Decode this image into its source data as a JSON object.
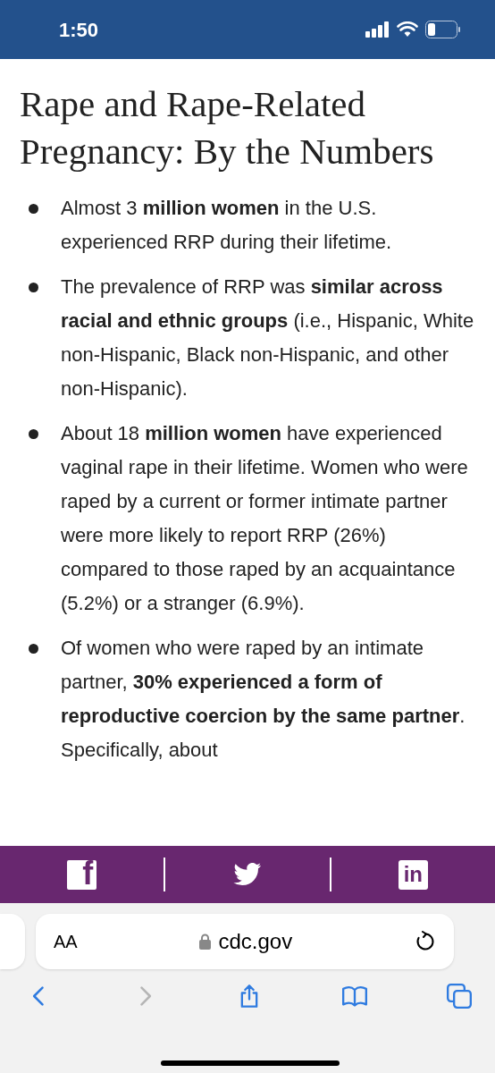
{
  "status_bar": {
    "time": "1:50"
  },
  "article": {
    "title": "Rape and Rape-Related Pregnancy: By the Numbers",
    "bullets": [
      "Almost 3 **million women** in the U.S. experienced RRP during their lifetime.",
      "The prevalence of RRP was **similar across racial and ethnic groups** (i.e., Hispanic, White non-Hispanic, Black non-Hispanic, and other non-Hispanic).",
      "About 18 **million women** have experienced vaginal rape in their lifetime. Women who were raped by a current or former intimate partner were more likely to report RRP (26%) compared to those raped by an acquaintance (5.2%) or a stranger (6.9%).",
      "Of women who were raped by an intimate partner, **30% experienced a form of reproductive coercion by the same partner**. Specifically, about"
    ]
  },
  "share_bar": [
    {
      "kind": "facebook",
      "label": "f"
    },
    {
      "kind": "twitter"
    },
    {
      "kind": "linkedin",
      "label": "in"
    }
  ],
  "address_bar": {
    "text_size_button": "AA",
    "domain": "cdc.gov"
  },
  "toolbar": [
    {
      "kind": "back",
      "disabled": false
    },
    {
      "kind": "forward",
      "disabled": true
    },
    {
      "kind": "share",
      "disabled": false
    },
    {
      "kind": "bookmarks",
      "disabled": false
    },
    {
      "kind": "tabs",
      "disabled": false
    }
  ]
}
